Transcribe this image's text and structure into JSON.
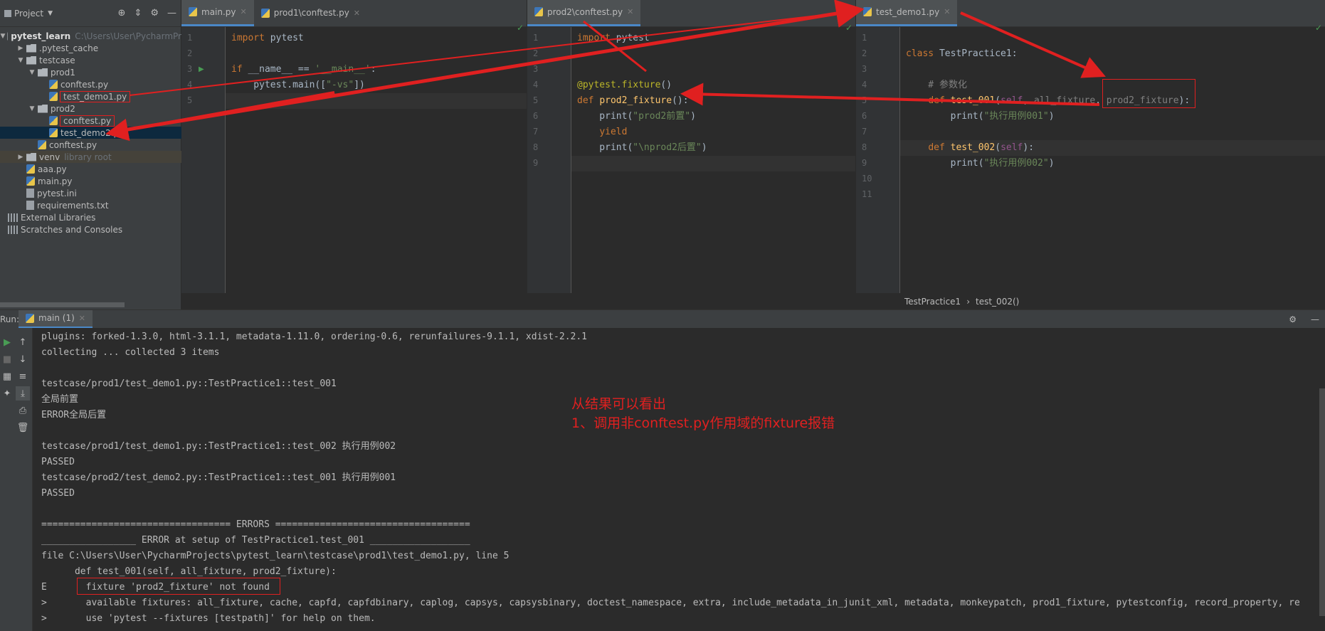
{
  "project": {
    "title": "Project",
    "tree": [
      {
        "label": "pytest_learn",
        "hint": "C:\\Users\\User\\PycharmPr",
        "indent": 0,
        "type": "folder",
        "expanded": true,
        "bold": true
      },
      {
        "label": ".pytest_cache",
        "indent": 1,
        "type": "folder",
        "expanded": false
      },
      {
        "label": "testcase",
        "indent": 1,
        "type": "folder",
        "expanded": true
      },
      {
        "label": "prod1",
        "indent": 2,
        "type": "folder",
        "expanded": true
      },
      {
        "label": "conftest.py",
        "indent": 3,
        "type": "py"
      },
      {
        "label": "test_demo1.py",
        "indent": 3,
        "type": "py",
        "boxed": true
      },
      {
        "label": "prod2",
        "indent": 2,
        "type": "folder",
        "expanded": true
      },
      {
        "label": "conftest.py",
        "indent": 3,
        "type": "py",
        "boxed": true
      },
      {
        "label": "test_demo2.py",
        "indent": 3,
        "type": "py",
        "selected": true
      },
      {
        "label": "conftest.py",
        "indent": 2,
        "type": "py"
      },
      {
        "label": "venv",
        "hint": "library root",
        "indent": 1,
        "type": "folder",
        "expanded": false,
        "venv": true
      },
      {
        "label": "aaa.py",
        "indent": 1,
        "type": "py"
      },
      {
        "label": "main.py",
        "indent": 1,
        "type": "py"
      },
      {
        "label": "pytest.ini",
        "indent": 1,
        "type": "txt"
      },
      {
        "label": "requirements.txt",
        "indent": 1,
        "type": "txt"
      },
      {
        "label": "External Libraries",
        "indent": 0,
        "type": "lib"
      },
      {
        "label": "Scratches and Consoles",
        "indent": 0,
        "type": "lib"
      }
    ]
  },
  "editor1": {
    "tabs": [
      {
        "label": "main.py",
        "active": true
      },
      {
        "label": "prod1\\conftest.py",
        "active": false
      }
    ],
    "line_numbers": [
      "1",
      "2",
      "3",
      "4",
      "5"
    ],
    "lines": [
      [
        {
          "t": "import",
          "c": "kw"
        },
        {
          "t": " pytest",
          "c": "pl"
        }
      ],
      [],
      [
        {
          "t": "if",
          "c": "kw"
        },
        {
          "t": " __name__ == ",
          "c": "pl"
        },
        {
          "t": "'__main__'",
          "c": "str"
        },
        {
          "t": ":",
          "c": "pl"
        }
      ],
      [
        {
          "t": "    pytest.main([",
          "c": "pl"
        },
        {
          "t": "\"-vs\"",
          "c": "str"
        },
        {
          "t": "])",
          "c": "pl"
        }
      ],
      []
    ]
  },
  "editor2": {
    "tabs": [
      {
        "label": "prod2\\conftest.py",
        "active": true
      }
    ],
    "line_numbers": [
      "1",
      "2",
      "3",
      "4",
      "5",
      "6",
      "7",
      "8",
      "9"
    ],
    "lines": [
      [
        {
          "t": "import",
          "c": "kw"
        },
        {
          "t": " pytest",
          "c": "pl"
        }
      ],
      [],
      [],
      [
        {
          "t": "@pytest.fixture",
          "c": "dec"
        },
        {
          "t": "()",
          "c": "pl"
        }
      ],
      [
        {
          "t": "def",
          "c": "kw"
        },
        {
          "t": " ",
          "c": "pl"
        },
        {
          "t": "prod2_fixture",
          "c": "fn"
        },
        {
          "t": "():",
          "c": "pl"
        }
      ],
      [
        {
          "t": "    print(",
          "c": "pl"
        },
        {
          "t": "\"prod2前置\"",
          "c": "str"
        },
        {
          "t": ")",
          "c": "pl"
        }
      ],
      [
        {
          "t": "    ",
          "c": "pl"
        },
        {
          "t": "yield",
          "c": "kw"
        }
      ],
      [
        {
          "t": "    print(",
          "c": "pl"
        },
        {
          "t": "\"\\n",
          "c": "str"
        },
        {
          "t": "prod2后置\"",
          "c": "str"
        },
        {
          "t": ")",
          "c": "pl"
        }
      ],
      []
    ]
  },
  "editor3": {
    "tabs": [
      {
        "label": "test_demo1.py",
        "active": true
      }
    ],
    "line_numbers": [
      "1",
      "2",
      "3",
      "4",
      "5",
      "6",
      "7",
      "8",
      "9",
      "10",
      "11"
    ],
    "lines": [
      [],
      [
        {
          "t": "class",
          "c": "kw"
        },
        {
          "t": " TestPractice1:",
          "c": "pl"
        }
      ],
      [],
      [
        {
          "t": "    # 参数化",
          "c": "cmt"
        }
      ],
      [
        {
          "t": "    ",
          "c": "pl"
        },
        {
          "t": "def",
          "c": "kw"
        },
        {
          "t": " ",
          "c": "pl"
        },
        {
          "t": "test_001",
          "c": "fn"
        },
        {
          "t": "(",
          "c": "pl"
        },
        {
          "t": "self",
          "c": "self"
        },
        {
          "t": ", ",
          "c": "pl"
        },
        {
          "t": "all_fixture",
          "c": "gray"
        },
        {
          "t": ", ",
          "c": "pl"
        },
        {
          "t": "prod2_fixture",
          "c": "gray"
        },
        {
          "t": "):",
          "c": "pl"
        }
      ],
      [
        {
          "t": "        print(",
          "c": "pl"
        },
        {
          "t": "\"执行用例001\"",
          "c": "str"
        },
        {
          "t": ")",
          "c": "pl"
        }
      ],
      [],
      [
        {
          "t": "    ",
          "c": "pl"
        },
        {
          "t": "def",
          "c": "kw"
        },
        {
          "t": " ",
          "c": "pl"
        },
        {
          "t": "test_002",
          "c": "fn"
        },
        {
          "t": "(",
          "c": "pl"
        },
        {
          "t": "self",
          "c": "self"
        },
        {
          "t": "):",
          "c": "pl"
        }
      ],
      [
        {
          "t": "        print(",
          "c": "pl"
        },
        {
          "t": "\"执行用例002\"",
          "c": "str"
        },
        {
          "t": ")",
          "c": "pl"
        }
      ],
      [],
      []
    ]
  },
  "breadcrumb": {
    "items": [
      "TestPractice1",
      "test_002()"
    ],
    "sep": "›"
  },
  "run": {
    "label": "Run:",
    "tab_label": "main (1)",
    "console_lines": [
      "plugins: forked-1.3.0, html-3.1.1, metadata-1.11.0, ordering-0.6, rerunfailures-9.1.1, xdist-2.2.1",
      "collecting ... collected 3 items",
      "",
      "testcase/prod1/test_demo1.py::TestPractice1::test_001",
      "全局前置",
      "ERROR全局后置",
      "",
      "testcase/prod1/test_demo1.py::TestPractice1::test_002 执行用例002",
      "PASSED",
      "testcase/prod2/test_demo2.py::TestPractice1::test_001 执行用例001",
      "PASSED",
      "",
      "================================== ERRORS ===================================",
      "_________________ ERROR at setup of TestPractice1.test_001 __________________",
      "file C:\\Users\\User\\PycharmProjects\\pytest_learn\\testcase\\prod1\\test_demo1.py, line 5",
      "      def test_001(self, all_fixture, prod2_fixture):",
      "E       fixture 'prod2_fixture' not found",
      ">       available fixtures: all_fixture, cache, capfd, capfdbinary, caplog, capsys, capsysbinary, doctest_namespace, extra, include_metadata_in_junit_xml, metadata, monkeypatch, prod1_fixture, pytestconfig, record_property, re",
      ">       use 'pytest --fixtures [testpath]' for help on them."
    ]
  },
  "annotation": {
    "line1": "从结果可以看出",
    "line2": "1、调用非conftest.py作用域的fixture报错"
  },
  "colors": {
    "annotation_red": "#e02020",
    "accent": "#4a88c7",
    "background": "#2b2b2b",
    "panel": "#3c3f41"
  }
}
